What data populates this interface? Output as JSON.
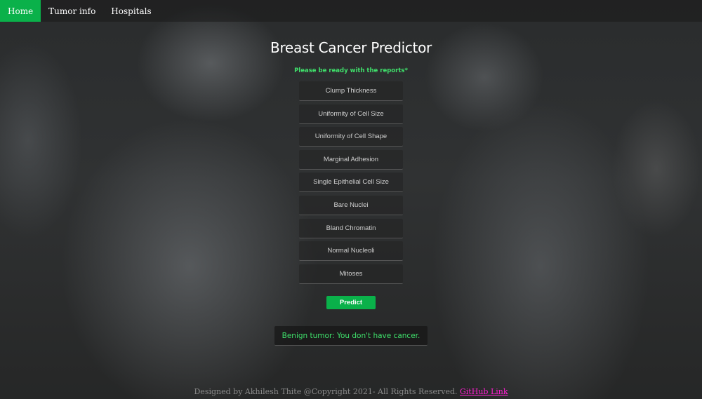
{
  "nav": {
    "items": [
      {
        "label": "Home",
        "active": true
      },
      {
        "label": "Tumor info",
        "active": false
      },
      {
        "label": "Hospitals",
        "active": false
      }
    ]
  },
  "main": {
    "title": "Breast Cancer Predictor",
    "subtitle": "Please be ready with the reports*",
    "fields": [
      {
        "placeholder": "Clump Thickness",
        "value": ""
      },
      {
        "placeholder": "Uniformity of Cell Size",
        "value": ""
      },
      {
        "placeholder": "Uniformity of Cell Shape",
        "value": ""
      },
      {
        "placeholder": "Marginal Adhesion",
        "value": ""
      },
      {
        "placeholder": "Single Epithelial Cell Size",
        "value": ""
      },
      {
        "placeholder": "Bare Nuclei",
        "value": ""
      },
      {
        "placeholder": "Bland Chromatin",
        "value": ""
      },
      {
        "placeholder": "Normal Nucleoli",
        "value": ""
      },
      {
        "placeholder": "Mitoses",
        "value": ""
      }
    ],
    "predict_label": "Predict",
    "result_text": "Benign tumor: You don't have cancer."
  },
  "footer": {
    "text": "Designed by Akhilesh Thite @Copyright 2021- All Rights Reserved.",
    "link_label": "GitHub Link"
  },
  "colors": {
    "accent": "#0ab14a",
    "result_text": "#3fe06b",
    "link": "#ff1fd2"
  }
}
